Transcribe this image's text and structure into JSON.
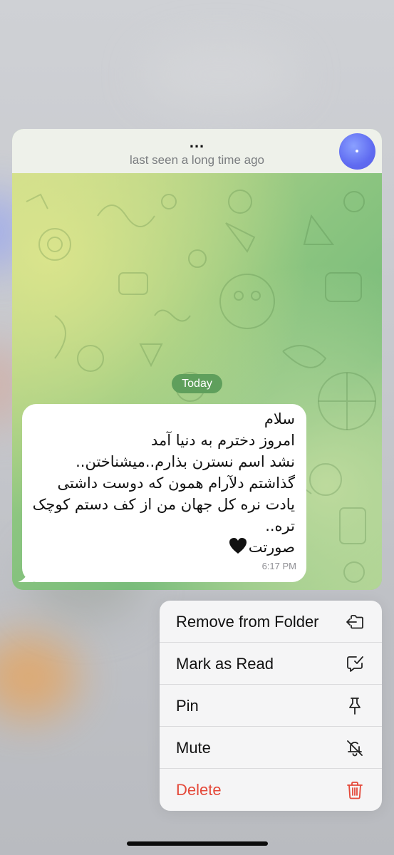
{
  "chat": {
    "title": "...",
    "status": "last seen a long time ago",
    "date_chip": "Today",
    "message": {
      "lines": [
        "سلام",
        "امروز دخترم به دنیا آمد",
        "نشد اسم نسترن بذارم..میشناختن..",
        "گذاشتم دلآرام همون که دوست داشتی",
        "یادت نره کل جهان من از کف دستم کوچک",
        "تره..",
        "صورتت"
      ],
      "time": "6:17 PM"
    }
  },
  "menu": {
    "items": [
      {
        "label": "Remove from Folder",
        "icon": "folder-remove-icon"
      },
      {
        "label": "Mark as Read",
        "icon": "mark-read-icon"
      },
      {
        "label": "Pin",
        "icon": "pin-icon"
      },
      {
        "label": "Mute",
        "icon": "bell-mute-icon"
      },
      {
        "label": "Delete",
        "icon": "trash-icon"
      }
    ]
  },
  "colors": {
    "accent_green": "#5f9f5c",
    "delete_red": "#e4493a",
    "avatar_blue": "#5f6bf1"
  }
}
